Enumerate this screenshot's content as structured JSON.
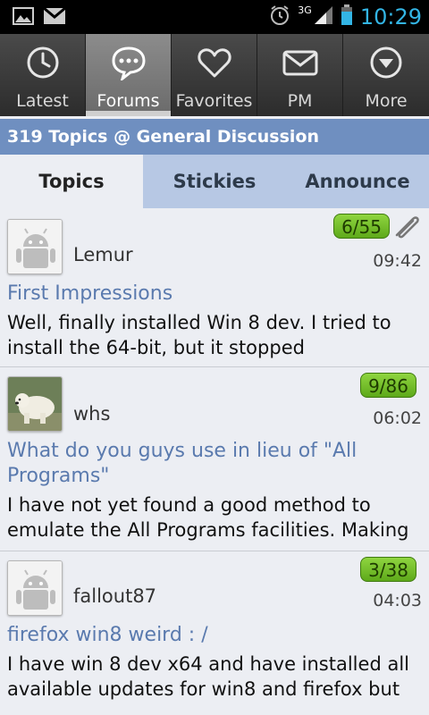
{
  "status_bar": {
    "network": "3G",
    "time": "10:29"
  },
  "tabs": [
    {
      "label": "Latest",
      "icon": "clock-icon",
      "active": false
    },
    {
      "label": "Forums",
      "icon": "chat-bubble-icon",
      "active": true
    },
    {
      "label": "Favorites",
      "icon": "heart-icon",
      "active": false
    },
    {
      "label": "PM",
      "icon": "envelope-icon",
      "active": false
    },
    {
      "label": "More",
      "icon": "down-circle-icon",
      "active": false
    }
  ],
  "header": {
    "title": "319 Topics @ General Discussion"
  },
  "subtabs": [
    {
      "label": "Topics",
      "active": true
    },
    {
      "label": "Stickies",
      "active": false
    },
    {
      "label": "Announce",
      "active": false
    }
  ],
  "topics": [
    {
      "author": "Lemur",
      "count": "6/55",
      "time": "09:42",
      "title": "First Impressions",
      "snippet": "Well, finally installed Win 8 dev. I tried to install the 64-bit, but it stopped",
      "has_attachment": true,
      "avatar": "android-icon"
    },
    {
      "author": "whs",
      "count": "9/86",
      "time": "06:02",
      "title": "What do you guys use in lieu of \"All Programs\"",
      "snippet": "I have not yet found a good method to emulate the All Programs facilities. Making",
      "has_attachment": false,
      "avatar": "polar-bear-photo"
    },
    {
      "author": "fallout87",
      "count": "3/38",
      "time": "04:03",
      "title": "firefox win8 weird : /",
      "snippet": "I have win 8 dev x64 and have installed all available updates for win8 and firefox but",
      "has_attachment": false,
      "avatar": "android-icon"
    }
  ]
}
